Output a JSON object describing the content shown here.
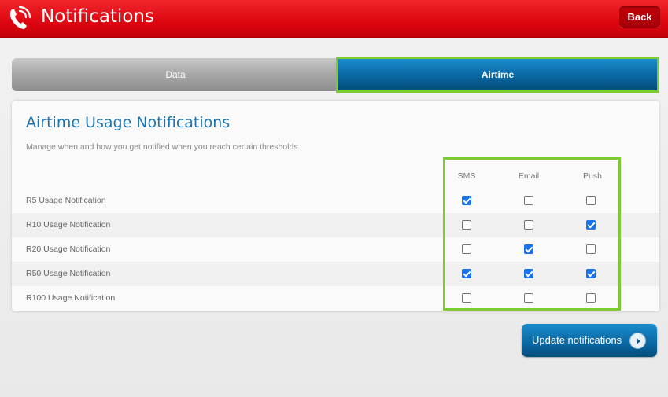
{
  "header": {
    "title": "Notifications",
    "back_label": "Back",
    "logo_icon": "phone-icon",
    "brand_color": "#e0040f"
  },
  "tabs": [
    {
      "label": "Data",
      "active": false
    },
    {
      "label": "Airtime",
      "active": true
    }
  ],
  "panel": {
    "title": "Airtime Usage Notifications",
    "subtitle": "Manage when and how you get notified when you reach certain thresholds.",
    "columns": [
      "SMS",
      "Email",
      "Push"
    ],
    "rows": [
      {
        "label": "R5 Usage Notification",
        "sms": true,
        "email": false,
        "push": false
      },
      {
        "label": "R10 Usage Notification",
        "sms": false,
        "email": false,
        "push": true
      },
      {
        "label": "R20 Usage Notification",
        "sms": false,
        "email": true,
        "push": false
      },
      {
        "label": "R50 Usage Notification",
        "sms": true,
        "email": true,
        "push": true
      },
      {
        "label": "R100 Usage Notification",
        "sms": false,
        "email": false,
        "push": false
      }
    ]
  },
  "footer": {
    "update_label": "Update notifications",
    "update_icon": "chevron-right-icon"
  }
}
